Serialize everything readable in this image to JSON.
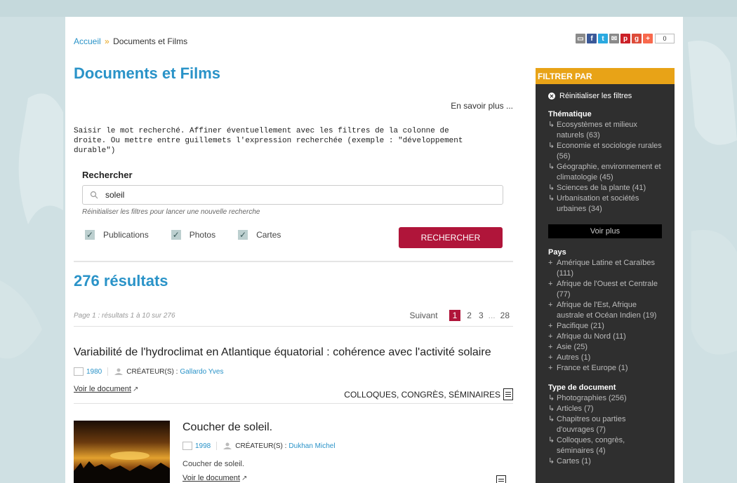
{
  "colors": {
    "accent": "#2a93c8",
    "brand": "#b0153a",
    "filter_header": "#e8a317",
    "sidebar_bg": "#2f2f2f"
  },
  "breadcrumb": {
    "home": "Accueil",
    "separator": "»",
    "current": "Documents et Films"
  },
  "share": {
    "icons": [
      "print-icon",
      "facebook-icon",
      "twitter-icon",
      "email-icon",
      "pinterest-icon",
      "googleplus-icon",
      "addthis-icon"
    ],
    "count": "0"
  },
  "main": {
    "title": "Documents et Films",
    "learn_more": "En savoir plus ...",
    "intro": "Saisir le mot recherché. Affiner éventuellement avec les filtres de la colonne de\ndroite. Ou mettre entre guillemets l'expression recherchée (exemple : \"développement\ndurable\")",
    "search": {
      "label": "Rechercher",
      "value": "soleil",
      "reset_hint": "Réinitialiser les filtres pour lancer une nouvelle recherche",
      "checkboxes": [
        {
          "label": "Publications",
          "checked": true
        },
        {
          "label": "Photos",
          "checked": true
        },
        {
          "label": "Cartes",
          "checked": true
        }
      ],
      "button": "RECHERCHER"
    },
    "results_count": "276 résultats",
    "page_info": "Page 1 : résultats 1 à 10 sur  276",
    "pager": {
      "next": "Suivant",
      "pages": [
        "1",
        "2",
        "3"
      ],
      "dots": "...",
      "last": "28"
    },
    "results": [
      {
        "title": "Variabilité de l'hydroclimat en Atlantique équatorial : cohérence avec l'activité solaire",
        "year": "1980",
        "creators_label": "Créateur(s) :",
        "creator": "Gallardo Yves",
        "link": "Voir le document",
        "link_arrow": "↗",
        "type": "COLLOQUES, CONGRÈS, SÉMINAIRES"
      },
      {
        "title": "Coucher de soleil.",
        "year": "1998",
        "creators_label": "Créateur(s) :",
        "creator": "Dukhan Michel",
        "description": "Coucher de soleil.",
        "link": "Voir le document",
        "link_arrow": "↗"
      }
    ]
  },
  "sidebar": {
    "header": "FILTRER PAR",
    "reset": "Réinitialiser les filtres",
    "thematique": {
      "title": "Thématique",
      "items": [
        "Ecosystèmes et milieux naturels (63)",
        "Economie et sociologie rurales (56)",
        "Géographie, environnement et climatologie (45)",
        "Sciences de la plante (41)",
        "Urbanisation et sociétés urbaines (34)"
      ],
      "more": "Voir plus"
    },
    "pays": {
      "title": "Pays",
      "items": [
        "Amérique Latine et Caraïbes (111)",
        "Afrique de l'Ouest et Centrale (77)",
        "Afrique de l'Est, Afrique australe et Océan Indien (19)",
        "Pacifique (21)",
        "Afrique du Nord (11)",
        "Asie (25)",
        "Autres (1)",
        "France et Europe (1)"
      ]
    },
    "type": {
      "title": "Type de document",
      "items": [
        "Photographies (256)",
        "Articles (7)",
        "Chapitres ou parties d'ouvrages (7)",
        "Colloques, congrès, séminaires (4)",
        "Cartes (1)"
      ]
    }
  }
}
